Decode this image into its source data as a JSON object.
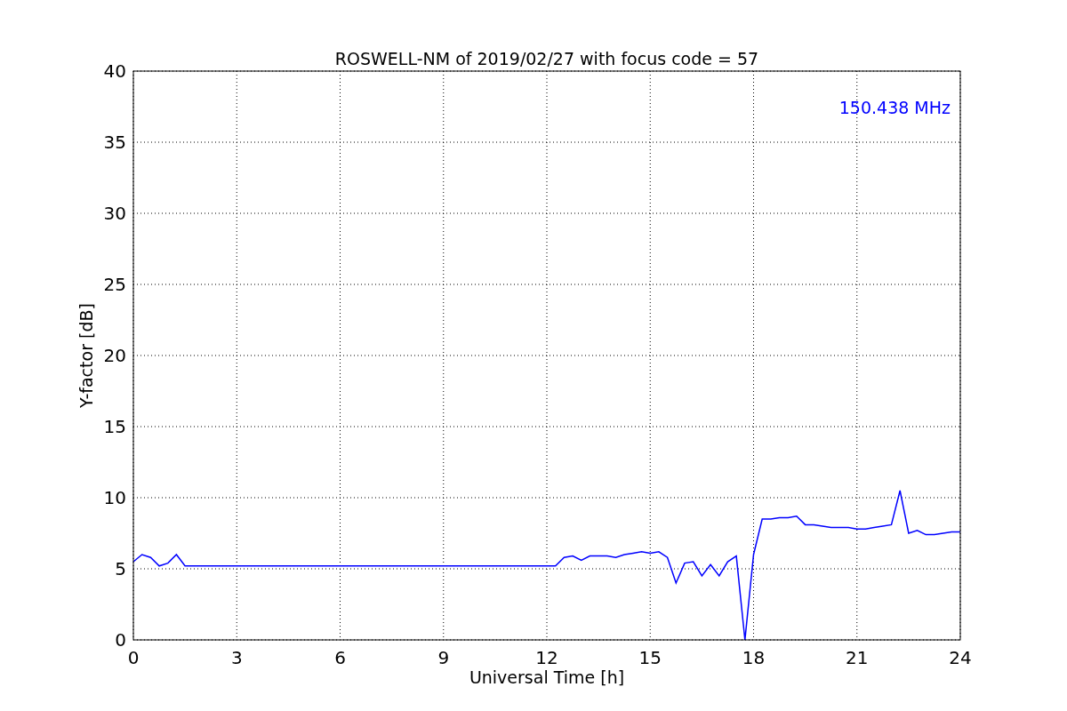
{
  "chart_data": {
    "type": "line",
    "title": "ROSWELL-NM of 2019/02/27 with focus code = 57",
    "xlabel": "Universal Time [h]",
    "ylabel": "Y-factor [dB]",
    "x": [
      0,
      0.25,
      0.5,
      0.75,
      1,
      1.25,
      1.5,
      12.25,
      12.5,
      12.75,
      13,
      13.25,
      13.5,
      13.75,
      14,
      14.25,
      14.5,
      14.75,
      15,
      15.25,
      15.5,
      15.75,
      16,
      16.25,
      16.5,
      16.75,
      17,
      17.25,
      17.5,
      17.75,
      18,
      18.25,
      18.5,
      18.75,
      19,
      19.25,
      19.5,
      19.75,
      20,
      20.25,
      20.5,
      20.75,
      21,
      21.25,
      21.5,
      21.75,
      22,
      22.25,
      22.5,
      22.75,
      23,
      23.25,
      23.5,
      23.75,
      24
    ],
    "series": [
      {
        "color": "#0000ff",
        "values": [
          5.5,
          6.0,
          5.8,
          5.2,
          5.4,
          6.0,
          5.2,
          5.2,
          5.8,
          5.9,
          5.6,
          5.9,
          5.9,
          5.9,
          5.8,
          6.0,
          6.1,
          6.2,
          6.1,
          6.2,
          5.8,
          4.0,
          5.4,
          5.5,
          4.5,
          5.3,
          4.5,
          5.5,
          5.9,
          0.0,
          6.0,
          8.5,
          8.5,
          8.6,
          8.6,
          8.7,
          8.1,
          8.1,
          8.0,
          7.9,
          7.9,
          7.9,
          7.8,
          7.8,
          7.9,
          8.0,
          8.1,
          10.5,
          7.5,
          7.7,
          7.4,
          7.4,
          7.5,
          7.6,
          7.6
        ]
      }
    ],
    "xlim": [
      0,
      24
    ],
    "ylim": [
      0,
      40
    ],
    "xticks": [
      0,
      3,
      6,
      9,
      12,
      15,
      18,
      21,
      24
    ],
    "yticks": [
      0,
      5,
      10,
      15,
      20,
      25,
      30,
      35,
      40
    ],
    "grid": true,
    "annotations": [
      "150.438 MHz"
    ]
  }
}
